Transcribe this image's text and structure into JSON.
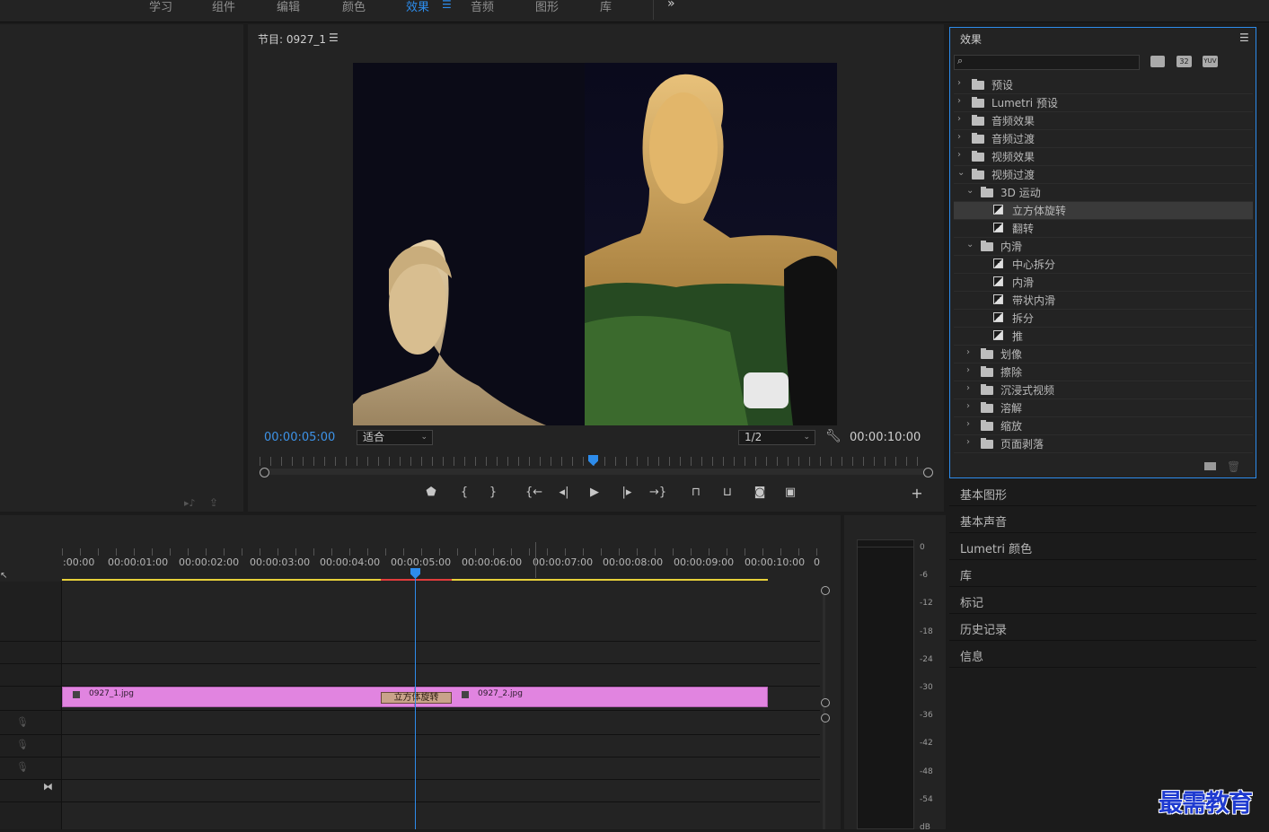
{
  "topnav": {
    "items": [
      "学习",
      "组件",
      "编辑",
      "颜色",
      "效果",
      "音频",
      "图形",
      "库"
    ],
    "active": "效果",
    "menu_icon": "hamburger-icon",
    "overflow_icon": "double-chevron-right-icon"
  },
  "program": {
    "title": "节目: 0927_1",
    "current_tc": "00:00:05:00",
    "zoom": "适合",
    "resolution": "1/2",
    "duration_tc": "00:00:10:00",
    "playhead_fraction": 0.5
  },
  "effects": {
    "title": "效果",
    "search_placeholder": "",
    "badges": [
      "32",
      "YUV"
    ],
    "tree": [
      {
        "label": "预设",
        "indent": 0,
        "kind": "folder-special",
        "open": false
      },
      {
        "label": "Lumetri 预设",
        "indent": 0,
        "kind": "folder-special",
        "open": false
      },
      {
        "label": "音频效果",
        "indent": 0,
        "kind": "folder",
        "open": false
      },
      {
        "label": "音频过渡",
        "indent": 0,
        "kind": "folder",
        "open": false
      },
      {
        "label": "视频效果",
        "indent": 0,
        "kind": "folder",
        "open": false
      },
      {
        "label": "视频过渡",
        "indent": 0,
        "kind": "folder",
        "open": true
      },
      {
        "label": "3D 运动",
        "indent": 1,
        "kind": "folder",
        "open": true
      },
      {
        "label": "立方体旋转",
        "indent": 2,
        "kind": "effect",
        "selected": true
      },
      {
        "label": "翻转",
        "indent": 2,
        "kind": "effect"
      },
      {
        "label": "内滑",
        "indent": 1,
        "kind": "folder",
        "open": true
      },
      {
        "label": "中心拆分",
        "indent": 2,
        "kind": "effect"
      },
      {
        "label": "内滑",
        "indent": 2,
        "kind": "effect"
      },
      {
        "label": "带状内滑",
        "indent": 2,
        "kind": "effect"
      },
      {
        "label": "拆分",
        "indent": 2,
        "kind": "effect"
      },
      {
        "label": "推",
        "indent": 2,
        "kind": "effect"
      },
      {
        "label": "划像",
        "indent": 1,
        "kind": "folder",
        "open": false
      },
      {
        "label": "擦除",
        "indent": 1,
        "kind": "folder",
        "open": false
      },
      {
        "label": "沉浸式视频",
        "indent": 1,
        "kind": "folder",
        "open": false
      },
      {
        "label": "溶解",
        "indent": 1,
        "kind": "folder",
        "open": false
      },
      {
        "label": "缩放",
        "indent": 1,
        "kind": "folder",
        "open": false
      },
      {
        "label": "页面剥落",
        "indent": 1,
        "kind": "folder",
        "open": false
      }
    ]
  },
  "side_tabs": [
    "基本图形",
    "基本声音",
    "Lumetri 颜色",
    "库",
    "标记",
    "历史记录",
    "信息"
  ],
  "timeline": {
    "ruler": [
      ":00:00",
      "00:00:01:00",
      "00:00:02:00",
      "00:00:03:00",
      "00:00:04:00",
      "00:00:05:00",
      "00:00:06:00",
      "00:00:07:00",
      "00:00:08:00",
      "00:00:09:00",
      "00:00:10:00",
      "0"
    ],
    "clip1": "0927_1.jpg",
    "clip2": "0927_2.jpg",
    "transition": "立方体旋转"
  },
  "meter": {
    "labels": [
      "0",
      "-6",
      "-12",
      "-18",
      "-24",
      "-30",
      "-36",
      "-42",
      "-48",
      "-54",
      "dB"
    ]
  },
  "watermark": "最需教育"
}
